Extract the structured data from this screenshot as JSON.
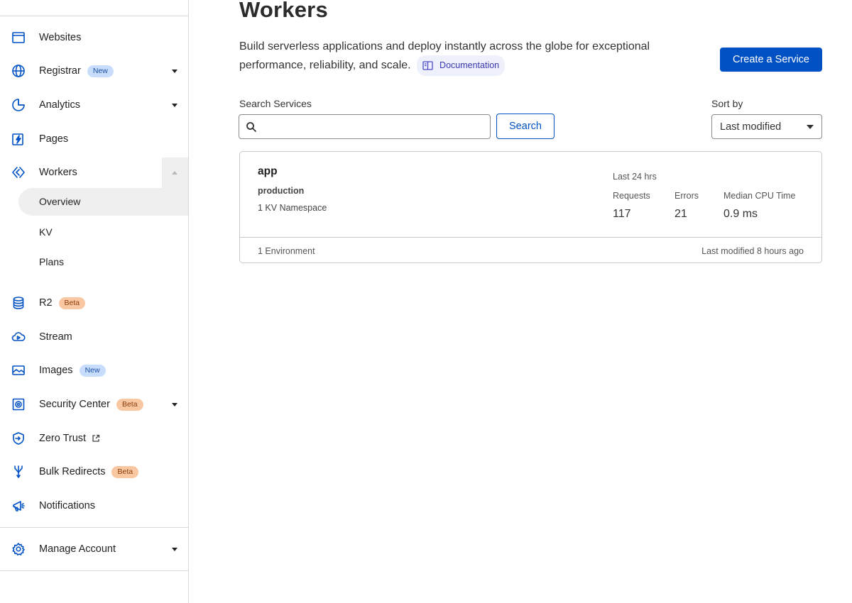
{
  "sidebar": {
    "items": [
      {
        "key": "websites",
        "label": "Websites",
        "icon": "browser-window-icon"
      },
      {
        "key": "registrar",
        "label": "Registrar",
        "icon": "globe-icon",
        "badge": "New",
        "badge_type": "new",
        "caret": true
      },
      {
        "key": "analytics",
        "label": "Analytics",
        "icon": "pie-chart-icon",
        "caret": true
      },
      {
        "key": "pages",
        "label": "Pages",
        "icon": "lightning-icon"
      },
      {
        "key": "workers",
        "label": "Workers",
        "icon": "workers-diamond-icon",
        "expanded": true
      },
      {
        "key": "r2",
        "label": "R2",
        "icon": "database-icon",
        "badge": "Beta",
        "badge_type": "beta"
      },
      {
        "key": "stream",
        "label": "Stream",
        "icon": "cloud-play-icon"
      },
      {
        "key": "images",
        "label": "Images",
        "icon": "image-icon",
        "badge": "New",
        "badge_type": "new"
      },
      {
        "key": "security-center",
        "label": "Security Center",
        "icon": "security-center-icon",
        "badge": "Beta",
        "badge_type": "beta",
        "caret": true
      },
      {
        "key": "zero-trust",
        "label": "Zero Trust",
        "icon": "shield-arrow-icon",
        "external": true
      },
      {
        "key": "bulk-redirects",
        "label": "Bulk Redirects",
        "icon": "redirect-icon",
        "badge": "Beta",
        "badge_type": "beta"
      },
      {
        "key": "notifications",
        "label": "Notifications",
        "icon": "megaphone-icon"
      },
      {
        "key": "manage-account",
        "label": "Manage Account",
        "icon": "gear-icon",
        "caret": true
      }
    ],
    "workers_sub": [
      {
        "label": "Overview",
        "active": true
      },
      {
        "label": "KV"
      },
      {
        "label": "Plans"
      }
    ]
  },
  "main": {
    "title": "Workers",
    "description": "Build serverless applications and deploy instantly across the globe for exceptional performance, reliability, and scale.",
    "doc_link": "Documentation",
    "create_button": "Create a Service",
    "search": {
      "label": "Search Services",
      "placeholder": "",
      "value": "",
      "button": "Search"
    },
    "sort": {
      "label": "Sort by",
      "value": "Last modified"
    },
    "service_card": {
      "name": "app",
      "environment": "production",
      "kv": "1 KV Namespace",
      "period": "Last 24 hrs",
      "stats": [
        {
          "label": "Requests",
          "value": "117"
        },
        {
          "label": "Errors",
          "value": "21"
        },
        {
          "label": "Median CPU Time",
          "value": "0.9 ms"
        }
      ],
      "env_count": "1 Environment",
      "last_modified": "Last modified 8 hours ago"
    }
  },
  "colors": {
    "accent": "#0051c3",
    "badge_new": "#c8ddfb",
    "badge_beta": "#f9c8a2"
  }
}
